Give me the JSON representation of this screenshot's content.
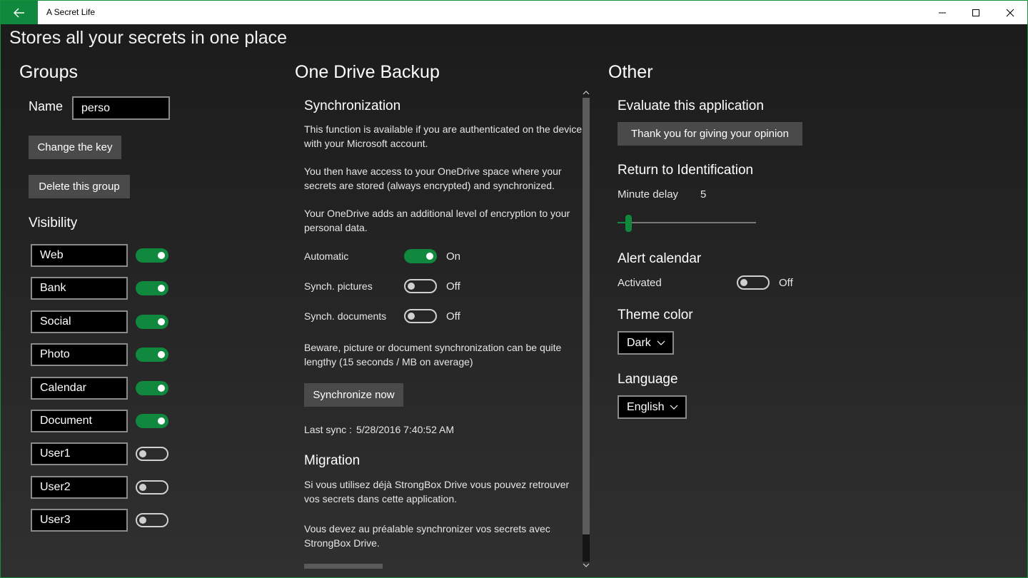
{
  "window": {
    "title": "A Secret Life",
    "accent": "#10893e"
  },
  "page": {
    "title": "Stores all your secrets in one place"
  },
  "groups": {
    "title": "Groups",
    "name_label": "Name",
    "name_value": "perso",
    "change_key_label": "Change the key",
    "delete_label": "Delete this group",
    "visibility_title": "Visibility",
    "items": [
      {
        "label": "Web",
        "on": true
      },
      {
        "label": "Bank",
        "on": true
      },
      {
        "label": "Social",
        "on": true
      },
      {
        "label": "Photo",
        "on": true
      },
      {
        "label": "Calendar",
        "on": true
      },
      {
        "label": "Document",
        "on": true
      },
      {
        "label": "User1",
        "on": false
      },
      {
        "label": "User2",
        "on": false
      },
      {
        "label": "User3",
        "on": false
      }
    ]
  },
  "backup": {
    "title": "One Drive Backup",
    "sync_title": "Synchronization",
    "para1": "This function is available if you are authenticated on the device with your Microsoft account.",
    "para2": "You then have access to your OneDrive space where your secrets are stored (always encrypted) and synchronized.",
    "para3": "Your OneDrive adds an additional level of encryption to your personal data.",
    "automatic_label": "Automatic",
    "automatic_state": "On",
    "pictures_label": "Synch. pictures",
    "pictures_state": "Off",
    "documents_label": "Synch. documents",
    "documents_state": "Off",
    "beware": "Beware, picture or document synchronization can be quite lengthy (15 seconds / MB on average)",
    "sync_now_label": "Synchronize now",
    "last_sync_label": "Last sync :",
    "last_sync_value": "5/28/2016 7:40:52 AM",
    "migration_title": "Migration",
    "migration_para1": "Si vous utilisez déjà StrongBox Drive vous pouvez retrouver vos secrets dans cette application.",
    "migration_para2": "Vous devez au préalable synchronizer vos secrets avec StrongBox Drive."
  },
  "other": {
    "title": "Other",
    "evaluate_title": "Evaluate this application",
    "opinion_label": "Thank you for giving your opinion",
    "return_title": "Return to Identification",
    "minute_label": "Minute delay",
    "minute_value": "5",
    "slider_fraction": 0.08,
    "alert_title": "Alert calendar",
    "activated_label": "Activated",
    "activated_state": "Off",
    "theme_title": "Theme color",
    "theme_value": "Dark",
    "language_title": "Language",
    "language_value": "English"
  }
}
